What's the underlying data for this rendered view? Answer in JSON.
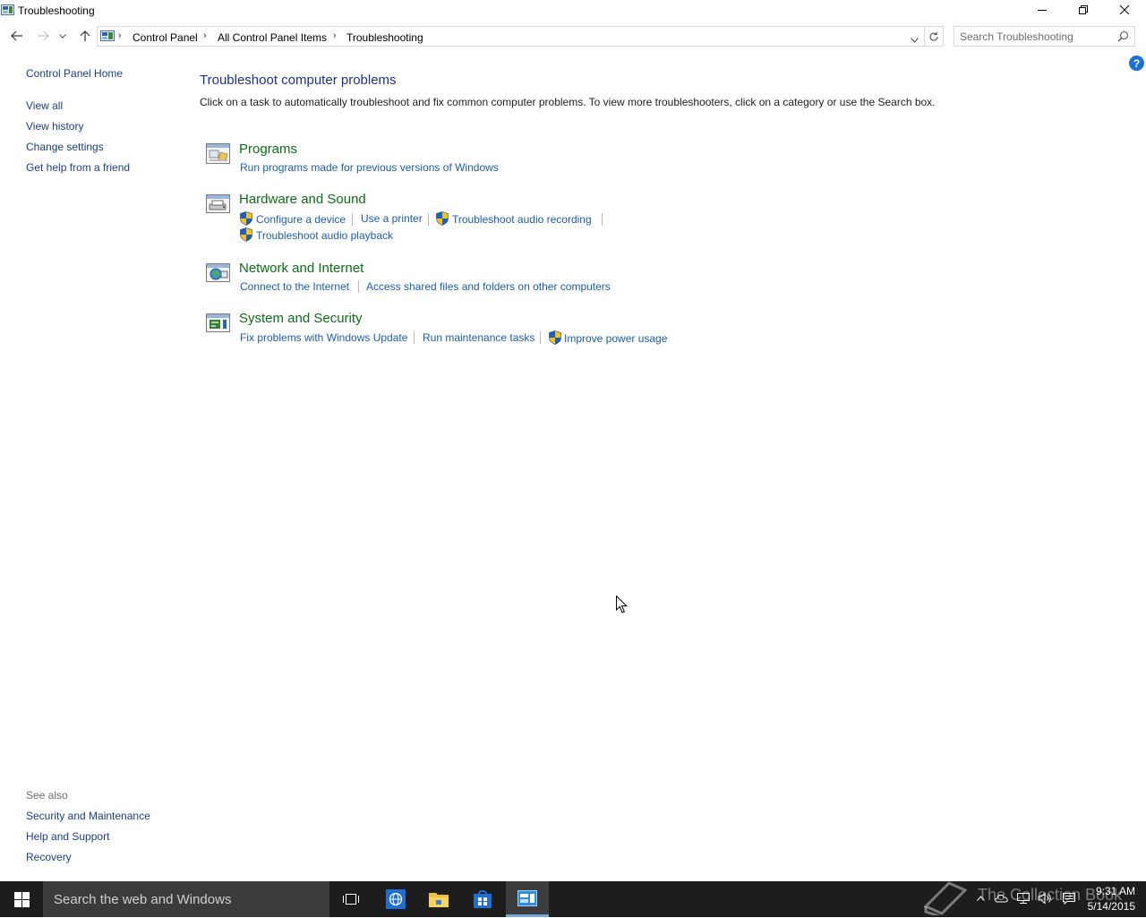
{
  "window": {
    "title": "Troubleshooting"
  },
  "address": {
    "breadcrumbs": [
      "Control Panel",
      "All Control Panel Items",
      "Troubleshooting"
    ]
  },
  "search": {
    "placeholder": "Search Troubleshooting"
  },
  "sidebar": {
    "home": "Control Panel Home",
    "links": [
      "View all",
      "View history",
      "Change settings",
      "Get help from a friend"
    ],
    "see_also_label": "See also",
    "see_also": [
      "Security and Maintenance",
      "Help and Support",
      "Recovery"
    ]
  },
  "main": {
    "heading": "Troubleshoot computer problems",
    "description": "Click on a task to automatically troubleshoot and fix common computer problems. To view more troubleshooters, click on a category or use the Search box.",
    "categories": [
      {
        "title": "Programs",
        "icon": "programs-icon",
        "tasks": [
          "Run programs made for previous versions of Windows"
        ]
      },
      {
        "title": "Hardware and Sound",
        "icon": "hardware-sound-icon",
        "tasks": [
          "Configure a device",
          "Use a printer",
          "Troubleshoot audio recording",
          "Troubleshoot audio playback"
        ]
      },
      {
        "title": "Network and Internet",
        "icon": "network-internet-icon",
        "tasks": [
          "Connect to the Internet",
          "Access shared files and folders on other computers"
        ]
      },
      {
        "title": "System and Security",
        "icon": "system-security-icon",
        "tasks": [
          "Fix problems with Windows Update",
          "Run maintenance tasks",
          "Improve power usage"
        ]
      }
    ]
  },
  "taskbar": {
    "search_placeholder": "Search the web and Windows",
    "time": "9:31 AM",
    "date": "5/14/2015",
    "watermark": "The Collection Book"
  },
  "colors": {
    "link": "#1b3e8c",
    "category": "#0d6d17",
    "task": "#1b5cb5",
    "heading": "#1e3287",
    "taskbar": "#1d1d1d"
  }
}
